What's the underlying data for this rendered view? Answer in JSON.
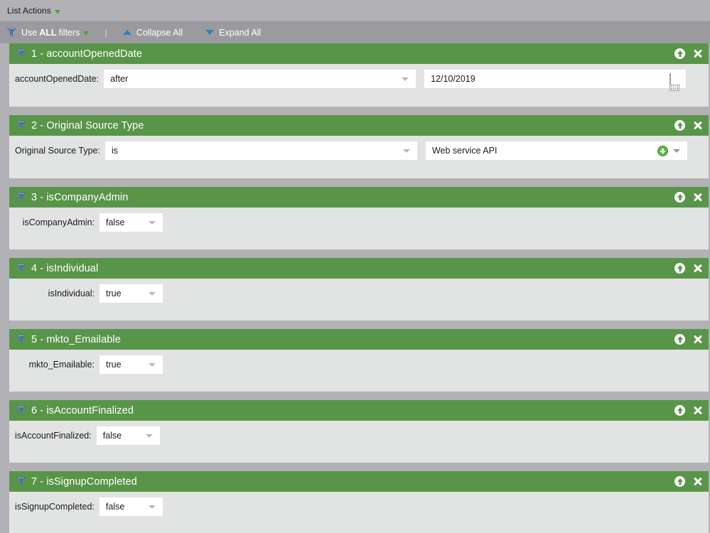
{
  "topbar": {
    "label": "List Actions",
    "caret_icon": "caret-down-green-icon"
  },
  "toolbar": {
    "use_filters_prefix": "Use",
    "use_filters_strong": "ALL",
    "use_filters_suffix": "filters",
    "separator": "|",
    "collapse_all": "Collapse All",
    "expand_all": "Expand All"
  },
  "colors": {
    "panel_header_green": "#599548",
    "panel_body_gray": "#e2e3e3",
    "page_gray": "#b2b2b6",
    "toolbar_gray": "#9b9b9f",
    "accent_blue": "#2f7fc1",
    "accent_green": "#52a02e"
  },
  "filters": [
    {
      "index": "1",
      "title": "1 - accountOpenedDate",
      "label": "accountOpenedDate:",
      "operator": "after",
      "value": "12/10/2019",
      "value_type": "date",
      "layout": "two-field"
    },
    {
      "index": "2",
      "title": "2 - Original Source Type",
      "label": "Original Source Type:",
      "operator": "is",
      "value": "Web service API",
      "value_type": "multiselect",
      "layout": "two-field"
    },
    {
      "index": "3",
      "title": "3 - isCompanyAdmin",
      "label": "isCompanyAdmin:",
      "operator": "false",
      "value": "",
      "value_type": "boolean",
      "layout": "bool"
    },
    {
      "index": "4",
      "title": "4 - isIndividual",
      "label": "isIndividual:",
      "operator": "true",
      "value": "",
      "value_type": "boolean",
      "layout": "bool"
    },
    {
      "index": "5",
      "title": "5 - mkto_Emailable",
      "label": "mkto_Emailable:",
      "operator": "true",
      "value": "",
      "value_type": "boolean",
      "layout": "bool"
    },
    {
      "index": "6",
      "title": "6 - isAccountFinalized",
      "label": "isAccountFinalized:",
      "operator": "false",
      "value": "",
      "value_type": "boolean",
      "layout": "bool"
    },
    {
      "index": "7",
      "title": "7 - isSignupCompleted",
      "label": "isSignupCompleted:",
      "operator": "false",
      "value": "",
      "value_type": "boolean",
      "layout": "bool"
    }
  ]
}
